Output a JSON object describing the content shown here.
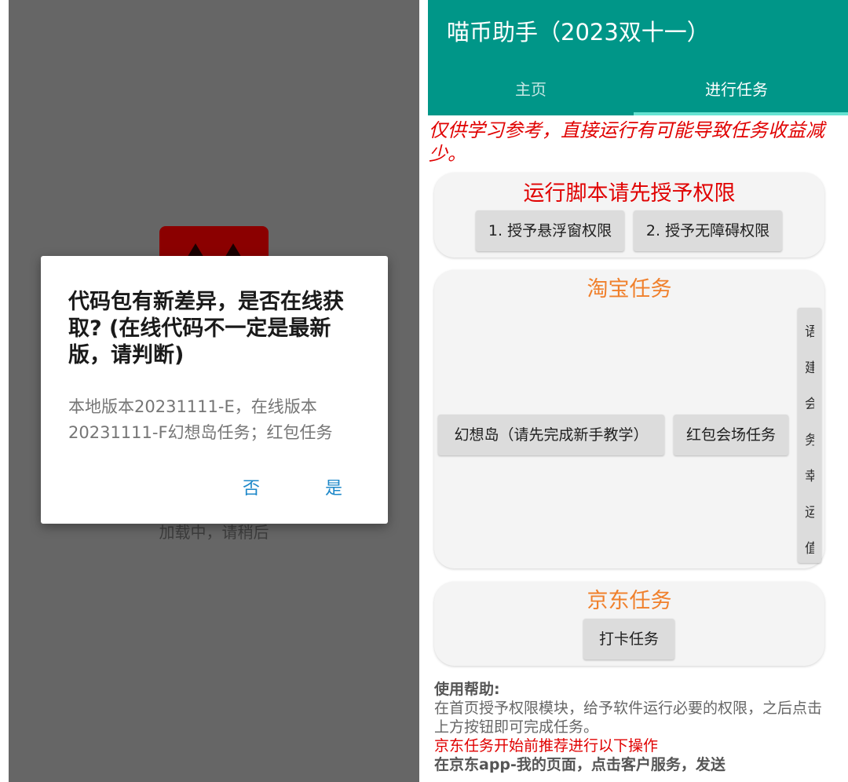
{
  "left_screen": {
    "loading_text": "加载中，请稍后",
    "dialog": {
      "title": "代码包有新差异，是否在线获取? (在线代码不一定是最新版，请判断)",
      "message": "本地版本20231111-E，在线版本20231111-F幻想岛任务；红包任务",
      "no_label": "否",
      "yes_label": "是"
    }
  },
  "right_screen": {
    "app_title": "喵币助手（2023双十一）",
    "tabs": [
      "主页",
      "进行任务"
    ],
    "active_tab": "进行任务",
    "warning": "仅供学习参考，直接运行有可能导致任务收益减少。",
    "permissions_card": {
      "title": "运行脚本请先授予权限",
      "buttons": [
        "1. 授予悬浮窗权限",
        "2. 授予无障碍权限"
      ]
    },
    "taobao_card": {
      "title": "淘宝任务",
      "buttons": [
        "幻想岛（请先完成新手教学）",
        "红包会场任务"
      ],
      "side_button_chars": [
        "语",
        "建",
        "会",
        "务",
        "幸",
        "运",
        "值"
      ]
    },
    "jd_card": {
      "title": "京东任务",
      "button": "打卡任务"
    },
    "help": {
      "heading": "使用帮助:",
      "line1": "在首页授予权限模块，给予软件运行必要的权限，之后点击上方按钮即可完成任务。",
      "line2": "京东任务开始前推荐进行以下操作",
      "line3": "在京东app-我的页面，点击客户服务，发送"
    }
  },
  "colors": {
    "app_bar": "#009688",
    "warning_red": "#e00000",
    "card_title_orange": "#f0802c",
    "dialog_button_blue": "#1e88c9"
  }
}
